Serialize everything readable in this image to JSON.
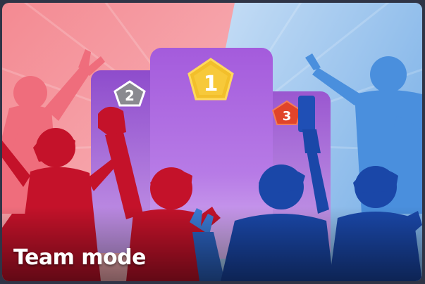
{
  "card": {
    "title": "Team mode"
  },
  "podium": {
    "first_label": "1",
    "second_label": "2",
    "third_label": "3"
  },
  "colors": {
    "red_team": "#c4122a",
    "blue_team": "#1a47a8",
    "podium_purple": "#a35fd6",
    "first_badge": "#f2bf2b",
    "second_badge": "#8a8a90",
    "third_badge": "#e0442a"
  },
  "icons": {
    "first_badge": "gold-pentagon-badge",
    "second_badge": "silver-pentagon-badge",
    "third_badge": "bronze-pentagon-badge"
  }
}
